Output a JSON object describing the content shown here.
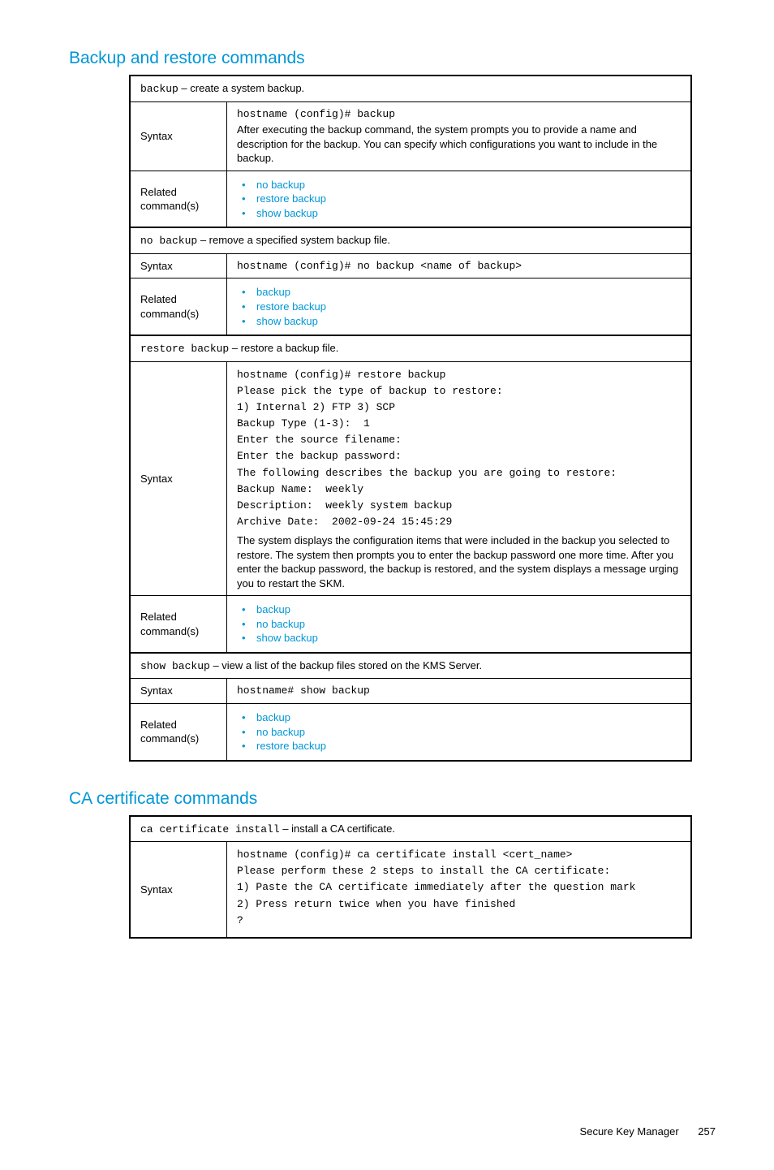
{
  "section1": {
    "title": "Backup and restore commands",
    "rows": [
      {
        "type": "head",
        "cmd": "backup",
        "desc": " – create a system backup."
      },
      {
        "type": "syntax",
        "label": "Syntax",
        "mono": "hostname (config)# backup",
        "desc": "After executing the backup command, the system prompts you to provide a name and description for the backup. You can specify which configurations you want to include in the backup."
      },
      {
        "type": "related",
        "label": "Related command(s)",
        "items": [
          "no backup",
          "restore backup",
          "show backup"
        ]
      },
      {
        "type": "head",
        "cmd": "no backup",
        "desc": " – remove a specified system backup file."
      },
      {
        "type": "syntax",
        "label": "Syntax",
        "mono": "hostname (config)# no backup <name of backup>"
      },
      {
        "type": "related",
        "label": "Related command(s)",
        "items": [
          "backup",
          "restore backup",
          "show backup"
        ]
      },
      {
        "type": "head",
        "cmd": "restore backup",
        "desc": " – restore a backup file."
      },
      {
        "type": "bigsyntax",
        "label": "Syntax",
        "lines": [
          "hostname (config)# restore backup",
          "Please pick the type of backup to restore:",
          "1) Internal 2) FTP 3) SCP",
          "Backup Type (1-3):  1",
          "Enter the source filename:",
          "Enter the backup password:",
          "The following describes the backup you are going to restore:",
          "Backup Name:  weekly",
          "Description:  weekly system backup",
          "Archive Date:  2002-09-24 15:45:29"
        ],
        "desc": "The system displays the configuration items that were included in the backup you selected to restore. The system then prompts you to enter the backup password one more time. After you enter the backup password, the backup is restored, and the system displays a message urging you to restart the SKM."
      },
      {
        "type": "related",
        "label": "Related command(s)",
        "items": [
          "backup",
          "no backup",
          "show backup"
        ]
      },
      {
        "type": "head",
        "cmd": "show backup",
        "desc": " – view a list of the backup files stored on the KMS Server."
      },
      {
        "type": "syntax",
        "label": "Syntax",
        "mono": "hostname# show backup"
      },
      {
        "type": "related",
        "label": "Related command(s)",
        "items": [
          "backup",
          "no backup",
          "restore backup"
        ]
      }
    ]
  },
  "section2": {
    "title": "CA certificate commands",
    "rows": [
      {
        "type": "head",
        "cmd": "ca certificate install",
        "desc": " – install a CA certificate."
      },
      {
        "type": "bigsyntax",
        "label": "Syntax",
        "lines": [
          "hostname (config)# ca certificate install <cert_name>",
          "Please perform these 2 steps to install the CA certificate:",
          "1) Paste the CA certificate immediately after the question mark",
          "2) Press return twice when you have finished",
          "?"
        ]
      }
    ]
  },
  "footer": {
    "text": "Secure Key Manager",
    "page": "257"
  }
}
